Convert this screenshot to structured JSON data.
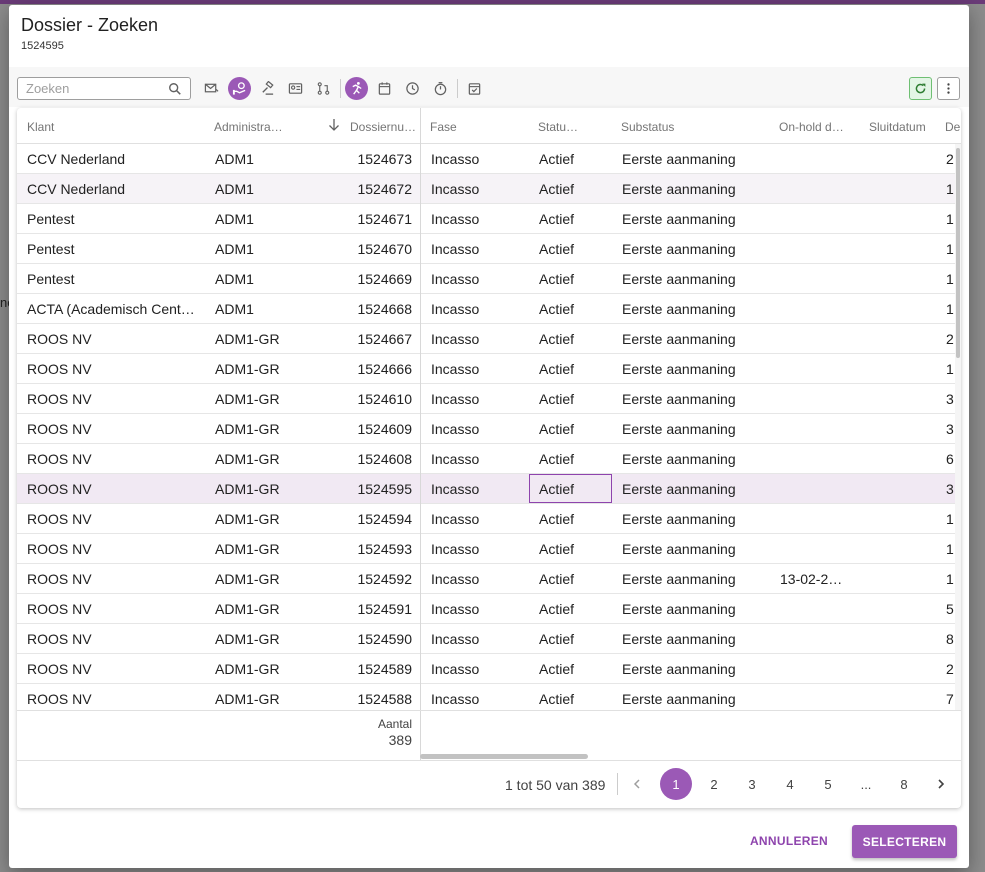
{
  "dialog": {
    "title": "Dossier - Zoeken",
    "subtitle": "1524595"
  },
  "backdrop_fragment": "ne",
  "toolbar": {
    "search_placeholder": "Zoeken",
    "buttons": [
      {
        "icon": "mail-icon",
        "active": false
      },
      {
        "icon": "hand-coin-icon",
        "active": true
      },
      {
        "icon": "gavel-icon",
        "active": false
      },
      {
        "icon": "id-card-icon",
        "active": false
      },
      {
        "icon": "workflow-icon",
        "active": false
      },
      {
        "icon": "running-icon",
        "active": true
      },
      {
        "icon": "calendar-icon",
        "active": false
      },
      {
        "icon": "clock-icon",
        "active": false
      },
      {
        "icon": "timer-icon",
        "active": false
      },
      {
        "icon": "calendar-check-icon",
        "active": false
      }
    ],
    "accent": "#9b59b6"
  },
  "grid": {
    "columns": [
      "Klant",
      "Administra…",
      "Dossiernu…",
      "Fase",
      "Statu…",
      "Substatus",
      "On-hold d…",
      "Sluitdatum",
      "De"
    ],
    "sort_column": "Dossiernu…",
    "sort_direction": "descending",
    "rows": [
      {
        "klant": "CCV Nederland",
        "admin": "ADM1",
        "nr": "1524673",
        "fase": "Incasso",
        "status": "Actief",
        "substatus": "Eerste aanmaning",
        "onhold": "",
        "sluit": "",
        "de": "2"
      },
      {
        "klant": "CCV Nederland",
        "admin": "ADM1",
        "nr": "1524672",
        "fase": "Incasso",
        "status": "Actief",
        "substatus": "Eerste aanmaning",
        "onhold": "",
        "sluit": "",
        "de": "1"
      },
      {
        "klant": "Pentest",
        "admin": "ADM1",
        "nr": "1524671",
        "fase": "Incasso",
        "status": "Actief",
        "substatus": "Eerste aanmaning",
        "onhold": "",
        "sluit": "",
        "de": "1"
      },
      {
        "klant": "Pentest",
        "admin": "ADM1",
        "nr": "1524670",
        "fase": "Incasso",
        "status": "Actief",
        "substatus": "Eerste aanmaning",
        "onhold": "",
        "sluit": "",
        "de": "1"
      },
      {
        "klant": "Pentest",
        "admin": "ADM1",
        "nr": "1524669",
        "fase": "Incasso",
        "status": "Actief",
        "substatus": "Eerste aanmaning",
        "onhold": "",
        "sluit": "",
        "de": "1"
      },
      {
        "klant": "ACTA (Academisch Centr…",
        "admin": "ADM1",
        "nr": "1524668",
        "fase": "Incasso",
        "status": "Actief",
        "substatus": "Eerste aanmaning",
        "onhold": "",
        "sluit": "",
        "de": "1"
      },
      {
        "klant": "ROOS NV",
        "admin": "ADM1-GR",
        "nr": "1524667",
        "fase": "Incasso",
        "status": "Actief",
        "substatus": "Eerste aanmaning",
        "onhold": "",
        "sluit": "",
        "de": "2"
      },
      {
        "klant": "ROOS NV",
        "admin": "ADM1-GR",
        "nr": "1524666",
        "fase": "Incasso",
        "status": "Actief",
        "substatus": "Eerste aanmaning",
        "onhold": "",
        "sluit": "",
        "de": "1"
      },
      {
        "klant": "ROOS NV",
        "admin": "ADM1-GR",
        "nr": "1524610",
        "fase": "Incasso",
        "status": "Actief",
        "substatus": "Eerste aanmaning",
        "onhold": "",
        "sluit": "",
        "de": "3"
      },
      {
        "klant": "ROOS NV",
        "admin": "ADM1-GR",
        "nr": "1524609",
        "fase": "Incasso",
        "status": "Actief",
        "substatus": "Eerste aanmaning",
        "onhold": "",
        "sluit": "",
        "de": "3"
      },
      {
        "klant": "ROOS NV",
        "admin": "ADM1-GR",
        "nr": "1524608",
        "fase": "Incasso",
        "status": "Actief",
        "substatus": "Eerste aanmaning",
        "onhold": "",
        "sluit": "",
        "de": "6"
      },
      {
        "klant": "ROOS NV",
        "admin": "ADM1-GR",
        "nr": "1524595",
        "fase": "Incasso",
        "status": "Actief",
        "substatus": "Eerste aanmaning",
        "onhold": "",
        "sluit": "",
        "de": "3"
      },
      {
        "klant": "ROOS NV",
        "admin": "ADM1-GR",
        "nr": "1524594",
        "fase": "Incasso",
        "status": "Actief",
        "substatus": "Eerste aanmaning",
        "onhold": "",
        "sluit": "",
        "de": "1"
      },
      {
        "klant": "ROOS NV",
        "admin": "ADM1-GR",
        "nr": "1524593",
        "fase": "Incasso",
        "status": "Actief",
        "substatus": "Eerste aanmaning",
        "onhold": "",
        "sluit": "",
        "de": "1"
      },
      {
        "klant": "ROOS NV",
        "admin": "ADM1-GR",
        "nr": "1524592",
        "fase": "Incasso",
        "status": "Actief",
        "substatus": "Eerste aanmaning",
        "onhold": "13-02-2…",
        "sluit": "",
        "de": "1"
      },
      {
        "klant": "ROOS NV",
        "admin": "ADM1-GR",
        "nr": "1524591",
        "fase": "Incasso",
        "status": "Actief",
        "substatus": "Eerste aanmaning",
        "onhold": "",
        "sluit": "",
        "de": "5"
      },
      {
        "klant": "ROOS NV",
        "admin": "ADM1-GR",
        "nr": "1524590",
        "fase": "Incasso",
        "status": "Actief",
        "substatus": "Eerste aanmaning",
        "onhold": "",
        "sluit": "",
        "de": "8"
      },
      {
        "klant": "ROOS NV",
        "admin": "ADM1-GR",
        "nr": "1524589",
        "fase": "Incasso",
        "status": "Actief",
        "substatus": "Eerste aanmaning",
        "onhold": "",
        "sluit": "",
        "de": "2"
      },
      {
        "klant": "ROOS NV",
        "admin": "ADM1-GR",
        "nr": "1524588",
        "fase": "Incasso",
        "status": "Actief",
        "substatus": "Eerste aanmaning",
        "onhold": "",
        "sluit": "",
        "de": "7"
      }
    ],
    "selected_row": 11,
    "alt_row": 1,
    "footer": {
      "aantal_label": "Aantal",
      "aantal_value": "389"
    }
  },
  "pager": {
    "range": "1 tot 50 van 389",
    "pages": [
      "1",
      "2",
      "3",
      "4",
      "5",
      "...",
      "8"
    ],
    "current": "1"
  },
  "actions": {
    "cancel": "ANNULEREN",
    "select": "SELECTEREN"
  }
}
